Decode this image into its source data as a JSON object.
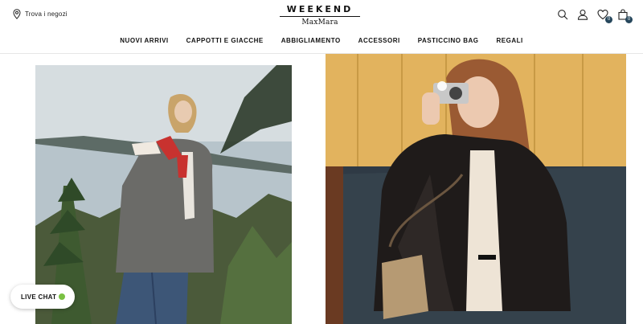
{
  "header": {
    "store_locator": "Trova i negozi",
    "logo_top": "WEEKEND",
    "logo_bottom": "MaxMara",
    "wishlist_count": "0",
    "cart_count": "0"
  },
  "nav": {
    "items": [
      "NUOVI ARRIVI",
      "CAPPOTTI E GIACCHE",
      "ABBIGLIAMENTO",
      "ACCESSORI",
      "PASTICCINO BAG",
      "REGALI"
    ]
  },
  "live_chat": {
    "label": "LIVE CHAT",
    "status_color": "#7ac143"
  },
  "colors": {
    "badge": "#26475c",
    "text": "#111111"
  }
}
